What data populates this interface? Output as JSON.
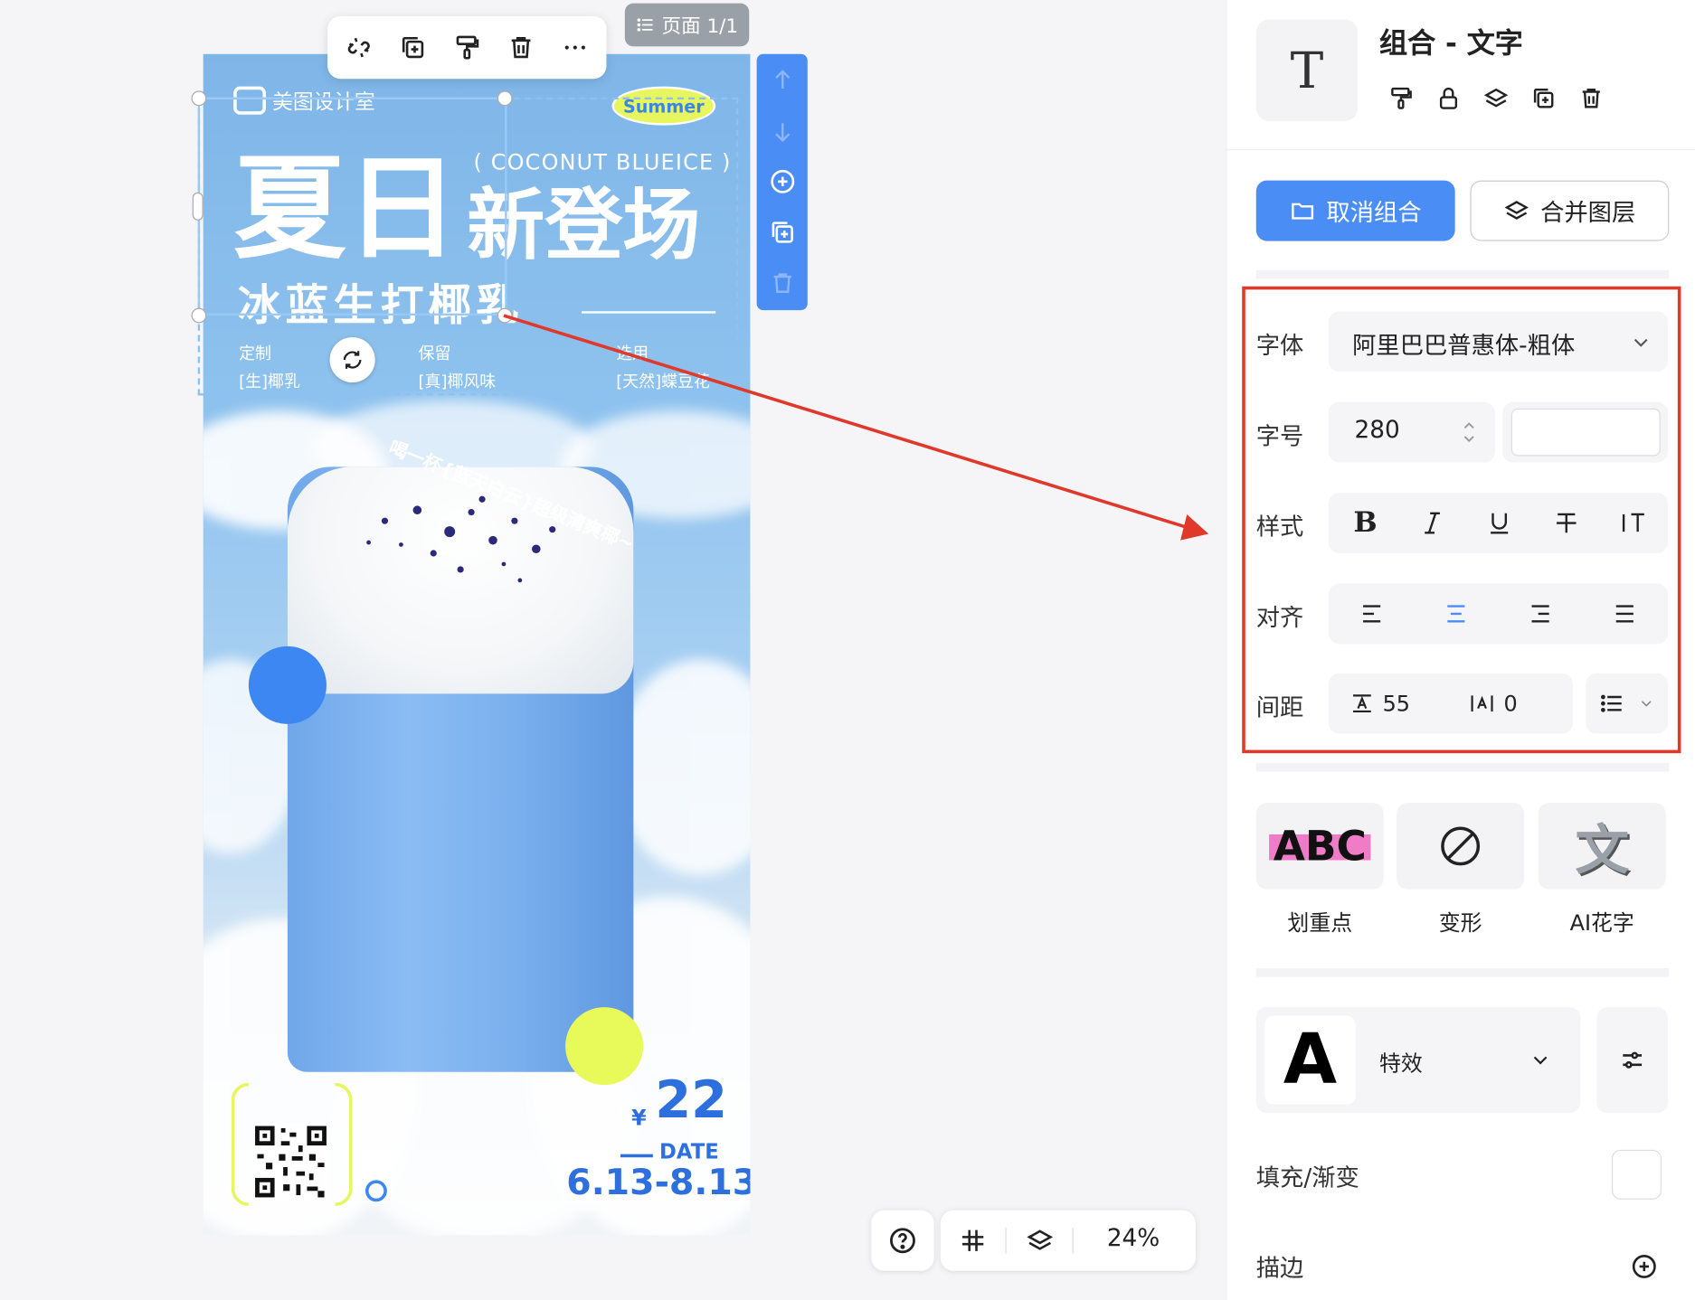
{
  "canvas": {
    "brand": "美图设计室",
    "badge": "Summer",
    "subtitle_en": "( COCONUT BLUEICE )",
    "title_line1a": "夏日",
    "title_line1b": "新登场",
    "title_line2": "冰蓝生打椰乳",
    "feature1_title": "定制",
    "feature1_text": "[生]椰乳",
    "feature2_title": "保留",
    "feature2_text": "[真]椰风味",
    "feature3_title": "选用",
    "feature3_text": "[天然]蝶豆花",
    "arc_text": "喝一杯{蓝天白云}超级清爽椰~",
    "currency": "¥",
    "price": "22",
    "date_label": "DATE",
    "date_range": "6.13-8.13"
  },
  "page_indicator": "页面 1/1",
  "bottom_bar": {
    "zoom": "24%"
  },
  "panel": {
    "title": "组合 - 文字",
    "preview_glyph": "T",
    "ungroup_label": "取消组合",
    "merge_label": "合并图层",
    "font_label": "字体",
    "font_value": "阿里巴巴普惠体-粗体",
    "size_label": "字号",
    "size_value": "280",
    "style_label": "样式",
    "align_label": "对齐",
    "spacing_label": "间距",
    "line_spacing": "55",
    "letter_spacing": "0",
    "effects": [
      {
        "label": "划重点",
        "thumb": "ABC"
      },
      {
        "label": "变形"
      },
      {
        "label": "AI花字",
        "thumb": "文"
      }
    ],
    "effect_preview": "A",
    "effect_select": "特效",
    "fill_label": "填充/渐变",
    "stroke_label": "描边"
  },
  "colors": {
    "accent": "#4a8df5",
    "highlight_box": "#e0392b"
  }
}
